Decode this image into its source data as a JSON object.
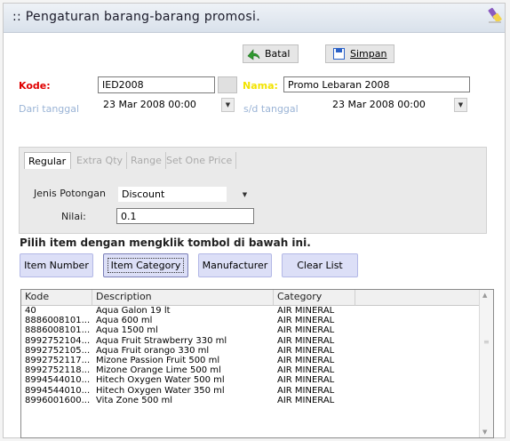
{
  "window": {
    "title": ":: Pengaturan barang-barang promosi.",
    "corner_icon": "eraser-icon"
  },
  "toolbar": {
    "cancel_label": "Batal",
    "save_label": "Simpan"
  },
  "form": {
    "kode_label": "Kode:",
    "kode_value": "IED2008",
    "nama_label": "Nama:",
    "nama_value": "Promo Lebaran 2008",
    "dari_label": "Dari tanggal",
    "dari_value": "23 Mar 2008 00:00",
    "sd_label": "s/d tanggal",
    "sd_value": "23 Mar 2008 00:00"
  },
  "tabs": [
    {
      "label": "Regular",
      "active": true
    },
    {
      "label": "Extra Qty",
      "active": false
    },
    {
      "label": "Range",
      "active": false
    },
    {
      "label": "Set One Price",
      "active": false
    }
  ],
  "regular": {
    "jenis_label": "Jenis Potongan",
    "jenis_value": "Discount",
    "nilai_label": "Nilai:",
    "nilai_value": "0.1"
  },
  "picker": {
    "title": "Pilih item dengan mengklik tombol di bawah ini.",
    "buttons": [
      "Item Number",
      "Item Category",
      "Manufacturer",
      "Clear List"
    ]
  },
  "list": {
    "columns": [
      "Kode",
      "Description",
      "Category"
    ],
    "rows": [
      [
        "40",
        "Aqua Galon 19 lt",
        "AIR MINERAL"
      ],
      [
        "8886008101...",
        "Aqua 600 ml",
        "AIR MINERAL"
      ],
      [
        "8886008101...",
        "Aqua 1500 ml",
        "AIR MINERAL"
      ],
      [
        "8992752104...",
        "Aqua Fruit Strawberry 330 ml",
        "AIR MINERAL"
      ],
      [
        "8992752105...",
        "Aqua Fruit orango 330 ml",
        "AIR MINERAL"
      ],
      [
        "8992752117...",
        "Mizone Passion Fruit 500 ml",
        "AIR MINERAL"
      ],
      [
        "8992752118...",
        "Mizone Orange Lime  500 ml",
        "AIR MINERAL"
      ],
      [
        "8994544010...",
        "Hitech Oxygen Water 500 ml",
        "AIR MINERAL"
      ],
      [
        "8994544010...",
        "Hitech Oxygen Water 350 ml",
        "AIR MINERAL"
      ],
      [
        "8996001600...",
        "Vita Zone 500 ml",
        "AIR MINERAL"
      ]
    ]
  },
  "colors": {
    "label_red": "#e00000",
    "label_blue": "#9bb4d6",
    "label_yellow": "#f2e300",
    "picker_button_bg": "#dcdff7"
  }
}
